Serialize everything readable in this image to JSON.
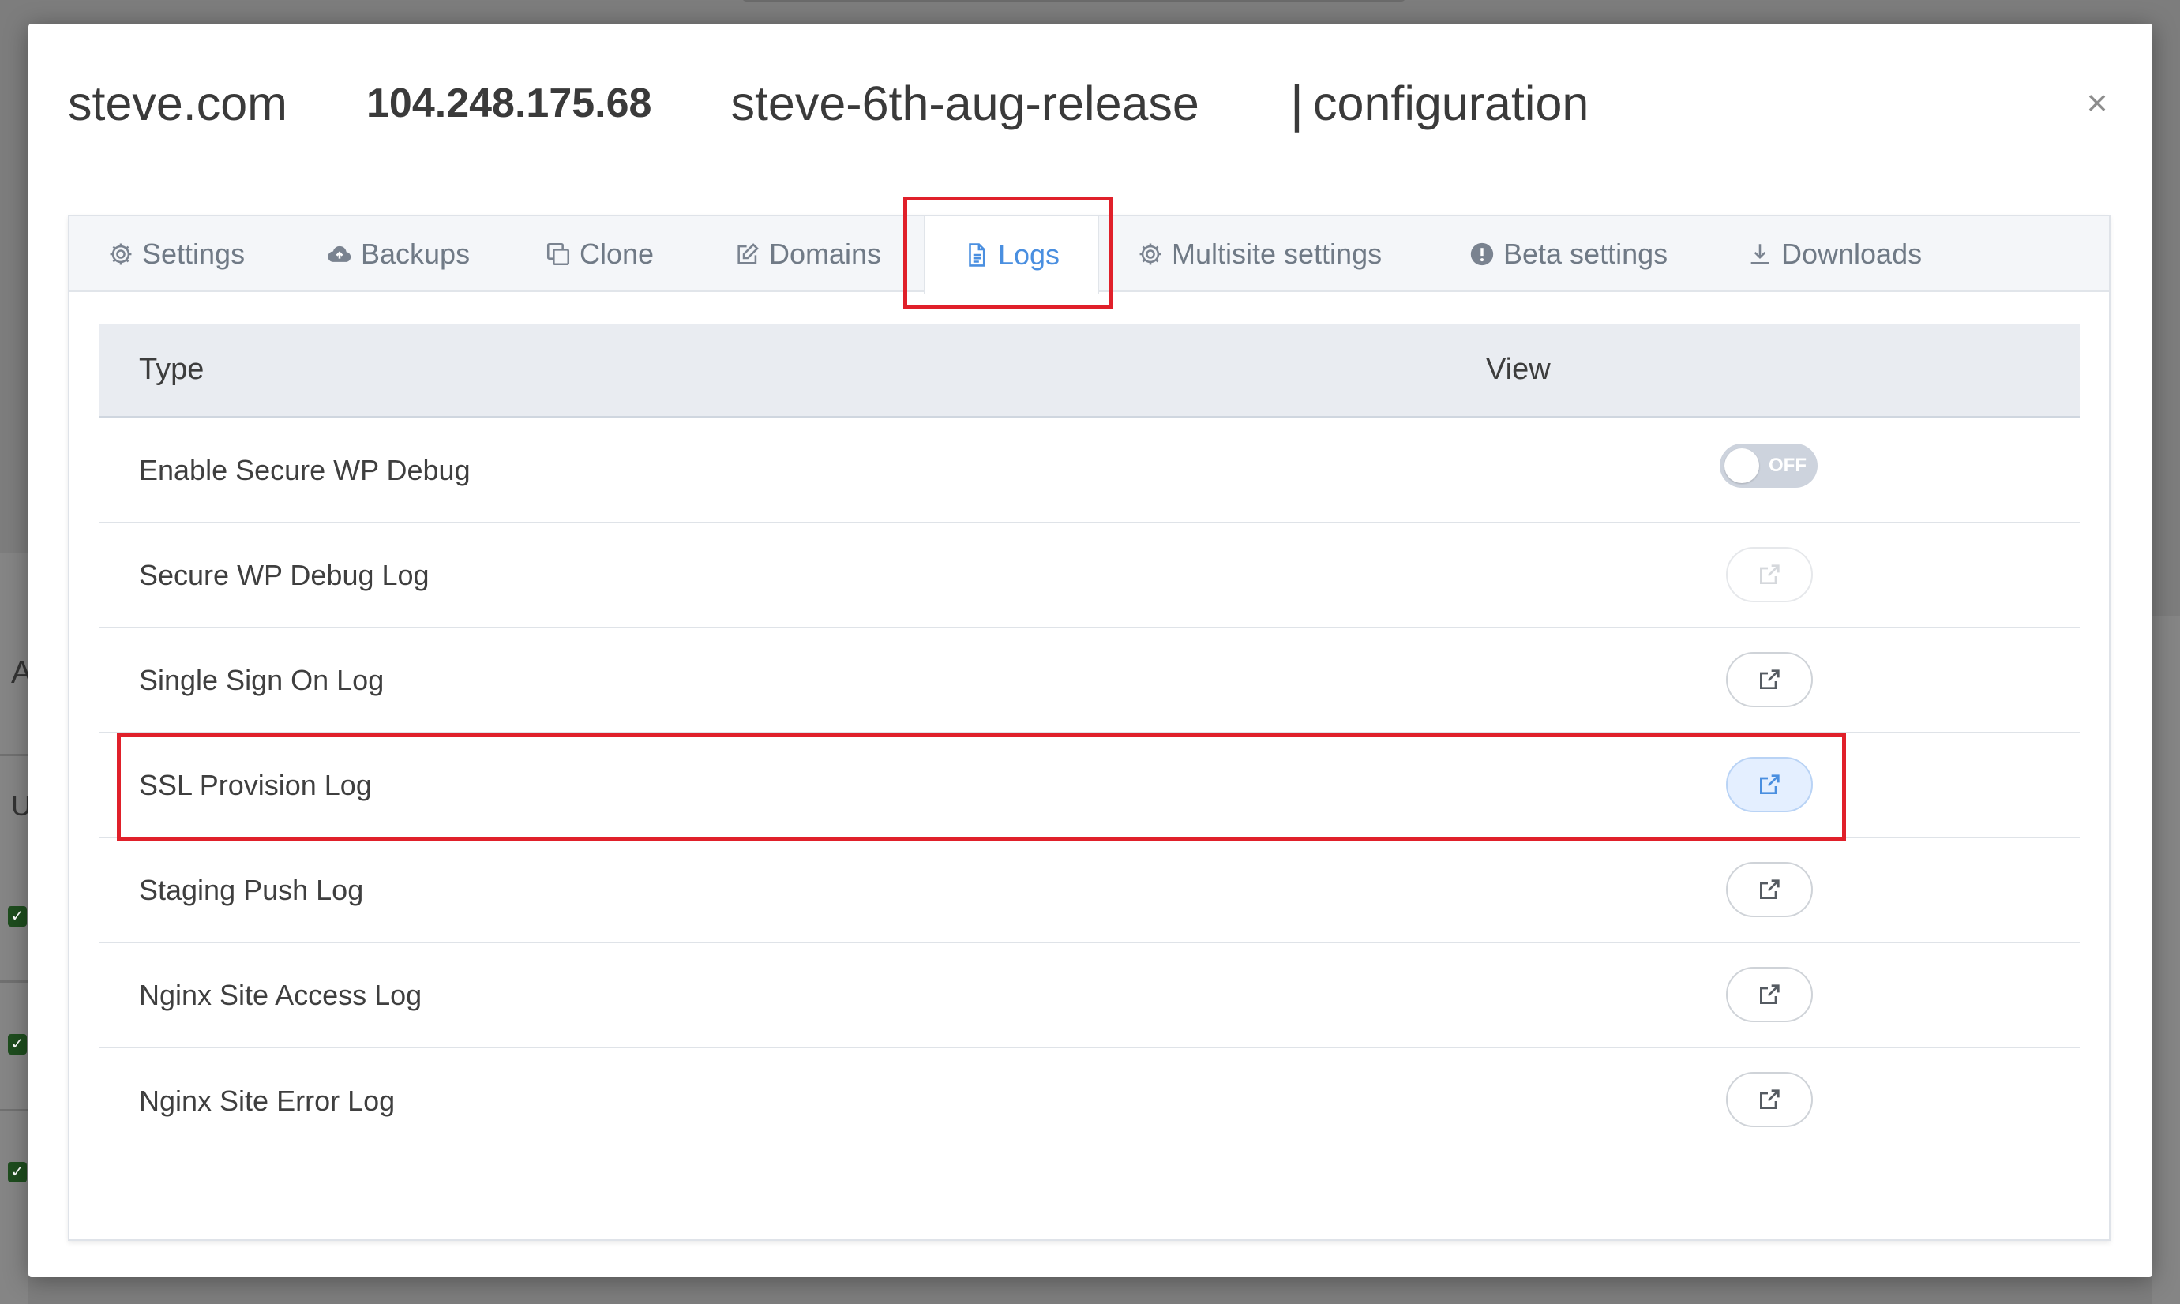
{
  "header": {
    "site": "steve.com",
    "ip": "104.248.175.68",
    "environment": "steve-6th-aug-release",
    "separator": "|",
    "section": "configuration",
    "close_label": "×"
  },
  "tabs": [
    {
      "label": "Settings",
      "icon": "gear-icon"
    },
    {
      "label": "Backups",
      "icon": "cloud-upload-icon"
    },
    {
      "label": "Clone",
      "icon": "copy-icon"
    },
    {
      "label": "Domains",
      "icon": "edit-icon"
    },
    {
      "label": "Logs",
      "icon": "document-icon",
      "active": true
    },
    {
      "label": "Multisite settings",
      "icon": "gear-icon"
    },
    {
      "label": "Beta settings",
      "icon": "alert-circle-icon"
    },
    {
      "label": "Downloads",
      "icon": "download-icon"
    }
  ],
  "table": {
    "headers": {
      "type": "Type",
      "view": "View"
    },
    "rows": [
      {
        "label": "Enable Secure WP Debug",
        "control": "toggle",
        "toggle_text": "OFF",
        "toggle_on": false
      },
      {
        "label": "Secure WP Debug Log",
        "control": "external-link",
        "state": "disabled"
      },
      {
        "label": "Single Sign On Log",
        "control": "external-link",
        "state": "normal"
      },
      {
        "label": "SSL Provision Log",
        "control": "external-link",
        "state": "selected"
      },
      {
        "label": "Staging Push Log",
        "control": "external-link",
        "state": "normal"
      },
      {
        "label": "Nginx Site Access Log",
        "control": "external-link",
        "state": "normal"
      },
      {
        "label": "Nginx Site Error Log",
        "control": "external-link",
        "state": "normal"
      }
    ]
  },
  "colors": {
    "accent": "#4a8fe0",
    "highlight_annotation": "#e0202a",
    "toggle_off": "#cdd3dd",
    "header_bg": "#e9ecf1"
  }
}
